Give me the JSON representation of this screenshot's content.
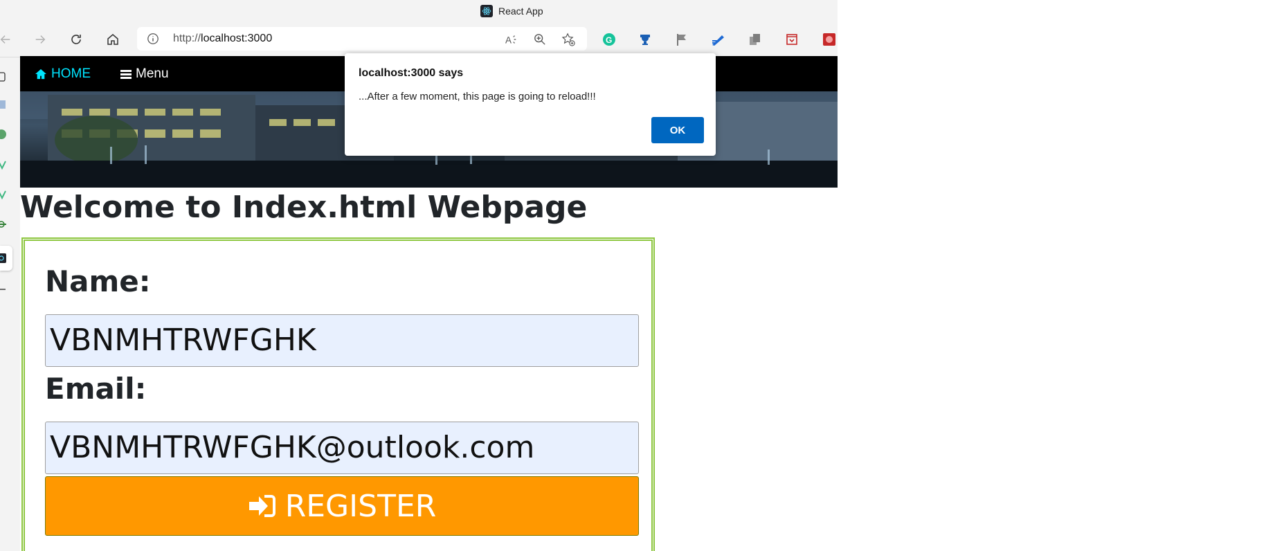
{
  "window": {
    "title": "React App"
  },
  "toolbar": {
    "url_scheme": "http://",
    "url_host": "localhost:3000"
  },
  "page": {
    "nav": {
      "home_label": "HOME",
      "menu_label": "Menu"
    },
    "heading": "Welcome to Index.html Webpage",
    "form": {
      "name_label": "Name:",
      "name_value": "VBNMHTRWFGHK",
      "email_label": "Email:",
      "email_value": "VBNMHTRWFGHK@outlook.com",
      "register_label": "REGISTER"
    }
  },
  "dialog": {
    "title": "localhost:3000 says",
    "message": "...After a few moment, this page is going to reload!!!",
    "ok_label": "OK"
  },
  "colors": {
    "nav_bg": "#000000",
    "home_link": "#00e5ff",
    "register_bg": "#ff9800",
    "form_border": "#8dc63f",
    "input_bg": "#e8f0fe",
    "dialog_ok": "#0067c0"
  },
  "icons": {
    "back": "arrow-left-icon",
    "forward": "arrow-right-icon",
    "reload": "reload-icon",
    "home": "home-icon",
    "site_info": "info-icon",
    "read_aloud": "read-aloud-icon",
    "zoom": "zoom-in-icon",
    "favorites": "add-favorite-icon",
    "register": "sign-in-icon"
  }
}
